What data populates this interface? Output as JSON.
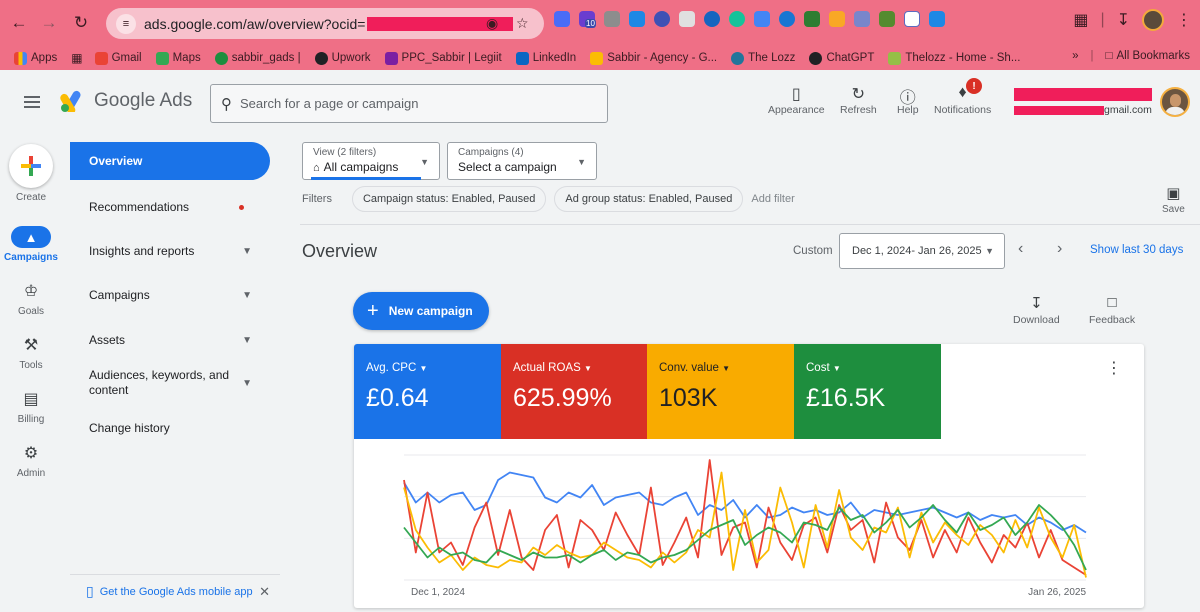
{
  "browser": {
    "url_prefix": "ads.google.com/aw/overview?ocid=",
    "bookmarks": [
      {
        "label": "Apps",
        "color": "#ea4335"
      },
      {
        "label": "Gmail",
        "color": "#ea4335"
      },
      {
        "label": "Maps",
        "color": "#34a853"
      },
      {
        "label": "sabbir_gads |",
        "color": "#1e8e3e"
      },
      {
        "label": "Upwork",
        "color": "#202124"
      },
      {
        "label": "PPC_Sabbir | Legiit",
        "color": "#7b1fa2"
      },
      {
        "label": "LinkedIn",
        "color": "#0a66c2"
      },
      {
        "label": "Sabbir - Agency - G...",
        "color": "#fbbc04"
      },
      {
        "label": "The Lozz",
        "color": "#21759b"
      },
      {
        "label": "ChatGPT",
        "color": "#202124"
      },
      {
        "label": "Thelozz - Home - Sh...",
        "color": "#95bf47"
      }
    ],
    "all_bookmarks": "All Bookmarks",
    "ext_badge": "10"
  },
  "header": {
    "product": "Google Ads",
    "search_placeholder": "Search for a page or campaign",
    "buttons": {
      "appearance": "Appearance",
      "refresh": "Refresh",
      "help": "Help",
      "notifications": "Notifications"
    },
    "notification_count": "!",
    "account_email_suffix": "gmail.com"
  },
  "rail": {
    "create": "Create",
    "campaigns": "Campaigns",
    "goals": "Goals",
    "tools": "Tools",
    "billing": "Billing",
    "admin": "Admin"
  },
  "nav": {
    "overview": "Overview",
    "recommendations": "Recommendations",
    "insights": "Insights and reports",
    "campaigns": "Campaigns",
    "assets": "Assets",
    "audiences": "Audiences, keywords, and content",
    "change_history": "Change history",
    "mobile_app": "Get the Google Ads mobile app"
  },
  "filters": {
    "view_label": "View (2 filters)",
    "view_value": "All campaigns",
    "campaigns_label": "Campaigns (4)",
    "campaigns_value": "Select a campaign",
    "filters_label": "Filters",
    "chip1": "Campaign status: Enabled, Paused",
    "chip2": "Ad group status: Enabled, Paused",
    "add_filter": "Add filter",
    "save": "Save"
  },
  "overview": {
    "title": "Overview",
    "custom": "Custom",
    "date_range": "Dec 1, 2024- Jan 26, 2025",
    "show_last": "Show last 30 days",
    "new_campaign": "New campaign",
    "download": "Download",
    "feedback": "Feedback"
  },
  "metrics": [
    {
      "label": "Avg. CPC",
      "value": "£0.64",
      "color": "#1a73e8"
    },
    {
      "label": "Actual ROAS",
      "value": "625.99%",
      "color": "#d93025"
    },
    {
      "label": "Conv. value",
      "value": "103K",
      "color": "#f9ab00"
    },
    {
      "label": "Cost",
      "value": "£16.5K",
      "color": "#1e8e3e"
    }
  ],
  "chart_data": {
    "type": "line",
    "x_start": "Dec 1, 2024",
    "x_end": "Jan 26, 2025",
    "grid": true,
    "series": [
      {
        "color": "#4285f4",
        "values": [
          78,
          62,
          70,
          62,
          68,
          70,
          56,
          60,
          80,
          86,
          84,
          82,
          66,
          62,
          70,
          66,
          76,
          60,
          66,
          68,
          70,
          62,
          60,
          66,
          70,
          52,
          60,
          56,
          64,
          50,
          60,
          50,
          52,
          58,
          54,
          56,
          52,
          54,
          62,
          50,
          56,
          54,
          52,
          54,
          56,
          58,
          54,
          50,
          54,
          48,
          52,
          50,
          52,
          44,
          50,
          46,
          40,
          44,
          38
        ]
      },
      {
        "color": "#ea4335",
        "values": [
          80,
          22,
          70,
          22,
          30,
          12,
          42,
          62,
          20,
          56,
          18,
          8,
          40,
          52,
          10,
          48,
          40,
          24,
          54,
          36,
          20,
          74,
          12,
          30,
          50,
          18,
          96,
          20,
          42,
          46,
          10,
          58,
          30,
          16,
          44,
          50,
          22,
          60,
          40,
          48,
          14,
          62,
          34,
          24,
          48,
          18,
          40,
          22,
          50,
          30,
          14,
          36,
          26,
          46,
          18,
          40,
          16,
          10,
          4
        ]
      },
      {
        "color": "#fbbc04",
        "values": [
          74,
          40,
          26,
          14,
          20,
          8,
          18,
          12,
          10,
          16,
          14,
          26,
          20,
          28,
          22,
          18,
          20,
          30,
          24,
          18,
          16,
          10,
          22,
          14,
          22,
          40,
          34,
          86,
          8,
          56,
          14,
          24,
          74,
          46,
          10,
          60,
          26,
          72,
          34,
          24,
          42,
          38,
          58,
          18,
          54,
          30,
          46,
          36,
          28,
          44,
          36,
          22,
          48,
          26,
          58,
          34,
          18,
          44,
          2
        ]
      },
      {
        "color": "#34a853",
        "values": [
          42,
          30,
          18,
          26,
          20,
          22,
          16,
          14,
          24,
          20,
          16,
          22,
          18,
          18,
          20,
          14,
          20,
          24,
          16,
          22,
          20,
          14,
          18,
          20,
          24,
          32,
          40,
          44,
          48,
          28,
          36,
          42,
          38,
          30,
          46,
          44,
          40,
          58,
          48,
          52,
          38,
          46,
          56,
          42,
          50,
          60,
          48,
          38,
          54,
          40,
          44,
          50,
          36,
          46,
          60,
          52,
          42,
          28,
          8
        ]
      }
    ]
  }
}
